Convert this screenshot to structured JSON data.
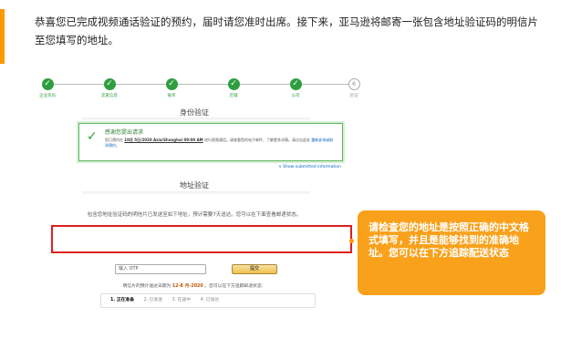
{
  "intro_text": "恭喜您已完成视频通话验证的预约，届时请您准时出席。接下来，亚马逊将邮寄一张包含地址验证码的明信片至您填写的地址。",
  "steps": [
    {
      "label": "企业资讯",
      "done": true
    },
    {
      "label": "卖家信息",
      "done": true
    },
    {
      "label": "账单",
      "done": true
    },
    {
      "label": "店铺",
      "done": true
    },
    {
      "label": "公司",
      "done": true
    },
    {
      "label": "验证",
      "done": false,
      "number": "6"
    }
  ],
  "identity_section_title": "身份验证",
  "notice": {
    "title": "感谢您提出请求",
    "body_prefix": "您已预约在",
    "booked_time": "10月 5日/2020 Asia/Shanghai 09:00 AM",
    "body_suffix": "进行视频通话。请查看您的电子邮件，了解更多详情。请点击此处",
    "link_text": "重新安排或取消预约。"
  },
  "show_info_link": "∨ Show submitted information",
  "address_section_title": "地址验证",
  "address_description": "包含您地址验证码的明信片已发送至如下地址，预计需要7天送达。您可以在下面查看邮递状态。",
  "otp": {
    "placeholder": "输入 OTP",
    "submit_label": "提交"
  },
  "eta": {
    "prefix": "明信片的预计送达日期为",
    "date": "12-8 月-2020",
    "suffix": "。您可以在下方追踪邮递状态："
  },
  "tracking_steps": [
    {
      "label": "1. 正在准备",
      "active": true
    },
    {
      "label": "2. 已发送",
      "active": false
    },
    {
      "label": "3. 在途中",
      "active": false
    },
    {
      "label": "4. 已送达",
      "active": false
    }
  ],
  "callout_text": "请检查您的地址是按照正确的中文格式填写，并且是能够找到的准确地址。您可以在下方追踪配送状态",
  "colors": {
    "accent": "#ff9900",
    "success": "#2e9e3f",
    "highlight_border": "#e01e1e",
    "callout": "#f9a11b"
  }
}
